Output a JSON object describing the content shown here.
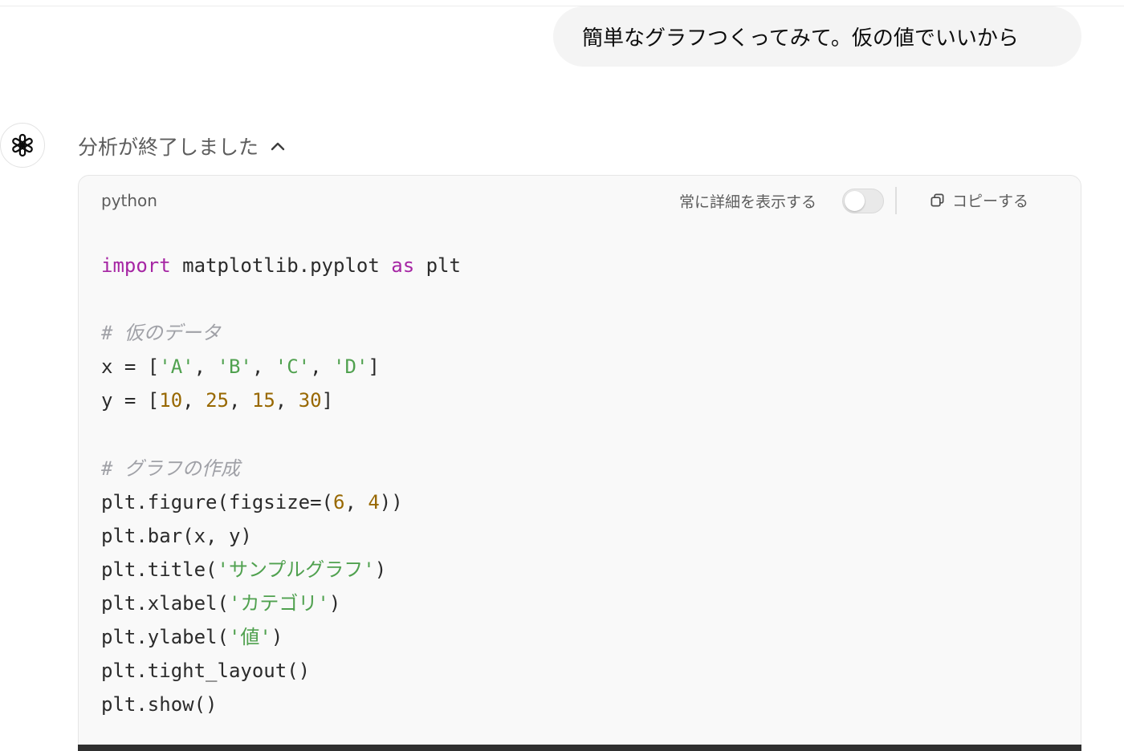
{
  "user_message": "簡単なグラフつくってみて。仮の値でいいから",
  "assistant": {
    "status_label": "分析が終了しました",
    "avatar_icon": "openai-logo-icon",
    "status_toggle_icon": "chevron-up-icon"
  },
  "code_block": {
    "language": "python",
    "always_show_details_label": "常に詳細を表示する",
    "always_show_details_on": false,
    "copy_label": "コピーする",
    "copy_icon": "copy-icon",
    "lines": [
      [
        {
          "t": "import",
          "c": "kw"
        },
        {
          "t": " matplotlib.pyplot "
        },
        {
          "t": "as",
          "c": "kw"
        },
        {
          "t": " plt"
        }
      ],
      [],
      [
        {
          "t": "# 仮のデータ",
          "c": "cmt"
        }
      ],
      [
        {
          "t": "x = ["
        },
        {
          "t": "'A'",
          "c": "str"
        },
        {
          "t": ", "
        },
        {
          "t": "'B'",
          "c": "str"
        },
        {
          "t": ", "
        },
        {
          "t": "'C'",
          "c": "str"
        },
        {
          "t": ", "
        },
        {
          "t": "'D'",
          "c": "str"
        },
        {
          "t": "]"
        }
      ],
      [
        {
          "t": "y = ["
        },
        {
          "t": "10",
          "c": "num"
        },
        {
          "t": ", "
        },
        {
          "t": "25",
          "c": "num"
        },
        {
          "t": ", "
        },
        {
          "t": "15",
          "c": "num"
        },
        {
          "t": ", "
        },
        {
          "t": "30",
          "c": "num"
        },
        {
          "t": "]"
        }
      ],
      [],
      [
        {
          "t": "# グラフの作成",
          "c": "cmt"
        }
      ],
      [
        {
          "t": "plt.figure(figsize=("
        },
        {
          "t": "6",
          "c": "num"
        },
        {
          "t": ", "
        },
        {
          "t": "4",
          "c": "num"
        },
        {
          "t": "))"
        }
      ],
      [
        {
          "t": "plt.bar(x, y)"
        }
      ],
      [
        {
          "t": "plt.title("
        },
        {
          "t": "'サンプルグラフ'",
          "c": "str"
        },
        {
          "t": ")"
        }
      ],
      [
        {
          "t": "plt.xlabel("
        },
        {
          "t": "'カテゴリ'",
          "c": "str"
        },
        {
          "t": ")"
        }
      ],
      [
        {
          "t": "plt.ylabel("
        },
        {
          "t": "'値'",
          "c": "str"
        },
        {
          "t": ")"
        }
      ],
      [
        {
          "t": "plt.tight_layout()"
        }
      ],
      [
        {
          "t": "plt.show()"
        }
      ]
    ]
  },
  "colors": {
    "keyword": "#a626a4",
    "string": "#50a14f",
    "number": "#986801",
    "comment": "#a0a1a7"
  }
}
